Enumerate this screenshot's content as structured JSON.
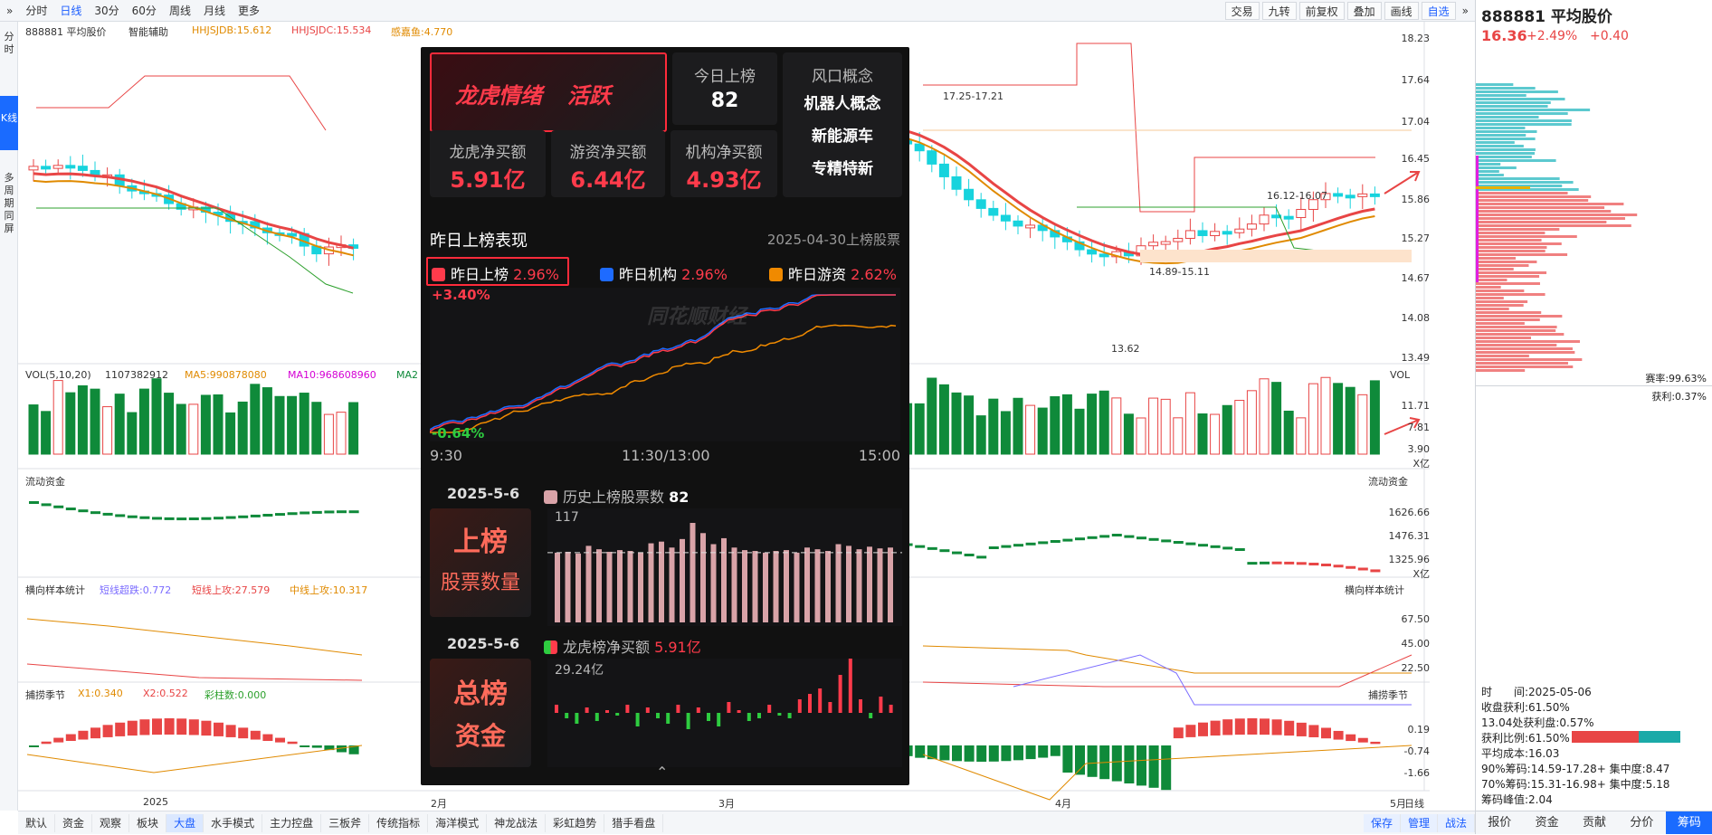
{
  "toolbar": {
    "chevron": "»",
    "periods": [
      "分时",
      "日线",
      "30分",
      "60分",
      "周线",
      "月线",
      "更多"
    ],
    "active_period": "日线",
    "right_items": [
      "交易",
      "九转",
      "前复权",
      "叠加",
      "画线",
      "自选"
    ],
    "right_chevron": "»"
  },
  "left_rail": {
    "items": [
      "分时",
      "K线",
      "多周期同屏"
    ],
    "active": "K线"
  },
  "main_chart": {
    "name": "888881 平均股价",
    "assist": "智能辅助",
    "indicators": [
      {
        "label": "HHJSJDB:15.612",
        "color": "#e08a00"
      },
      {
        "label": "HHJSJDC:15.534",
        "color": "#e84545"
      },
      {
        "label": "感嘉鱼:4.770",
        "color": "#e08a00"
      }
    ],
    "y_ticks": [
      "18.23",
      "17.64",
      "17.04",
      "16.45",
      "15.86",
      "15.27",
      "14.67",
      "14.08",
      "13.49"
    ],
    "annotations": [
      "17.25-17.21",
      "16.12-16.07",
      "14.89-15.11",
      "13.62"
    ]
  },
  "vol_panel": {
    "title": "VOL(5,10,20)",
    "value": "1107382912",
    "ma5": "MA5:990878080",
    "ma10": "MA10:968608960",
    "ma20": "MA2",
    "label_right": "VOL",
    "y_ticks": [
      "11.71",
      "7.81",
      "3.90",
      "X亿"
    ]
  },
  "flow_panel": {
    "title": "流动资金",
    "label_right": "流动资金",
    "y_ticks": [
      "1626.66",
      "1476.31",
      "1325.96",
      "X亿"
    ]
  },
  "sample_panel": {
    "title": "横向样本统计",
    "items": [
      {
        "label": "短线超跌:0.772",
        "color": "#7b6cff"
      },
      {
        "label": "短线上攻:27.579",
        "color": "#e84545"
      },
      {
        "label": "中线上攻:10.317",
        "color": "#e08a00"
      }
    ],
    "label_right": "横向样本统计",
    "y_ticks": [
      "67.50",
      "45.00",
      "22.50"
    ]
  },
  "season_panel": {
    "title": "捕捞季节",
    "items": [
      {
        "label": "X1:0.340",
        "color": "#e08a00"
      },
      {
        "label": "X2:0.522",
        "color": "#e84545"
      },
      {
        "label": "彩柱数:0.000",
        "color": "#2ca02c"
      }
    ],
    "label_right": "捕捞季节",
    "y_ticks": [
      "0.19",
      "-0.74",
      "-1.66"
    ]
  },
  "x_axis": {
    "labels": [
      "2025",
      "2月",
      "3月",
      "4月",
      "5月"
    ],
    "right_label": "日线"
  },
  "bottom_tabs": [
    "默认",
    "资金",
    "观察",
    "板块",
    "大盘",
    "水手模式",
    "主力控盘",
    "三板斧",
    "传统指标",
    "海洋模式",
    "神龙战法",
    "彩虹趋势",
    "猎手看盘"
  ],
  "bottom_active": "大盘",
  "bottom_right": [
    "保存",
    "管理",
    "战法"
  ],
  "popup": {
    "mood_title": "龙虎情绪",
    "mood_value": "活跃",
    "today_label": "今日上榜",
    "today_value": "82",
    "concept_title": "风口概念",
    "concepts": [
      "机器人概念",
      "新能源车",
      "专精特新"
    ],
    "buy_cells": [
      {
        "label": "龙虎净买额",
        "value": "5.91亿"
      },
      {
        "label": "游资净买额",
        "value": "6.44亿"
      },
      {
        "label": "机构净买额",
        "value": "4.93亿"
      }
    ],
    "perf_title": "昨日上榜表现",
    "perf_date": "2025-04-30上榜股票",
    "legend": [
      {
        "label": "昨日上榜",
        "value": "2.96%",
        "color": "#ff3b4b"
      },
      {
        "label": "昨日机构",
        "value": "2.96%",
        "color": "#1e6bff"
      },
      {
        "label": "昨日游资",
        "value": "2.62%",
        "color": "#f08a00"
      }
    ],
    "perf_high": "+3.40%",
    "perf_low": "-0.64%",
    "perf_times": [
      "9:30",
      "11:30/13:00",
      "15:00"
    ],
    "watermark": "同花顺财经",
    "count_date": "2025-5-6",
    "count_label": "历史上榜股票数",
    "count_value": "82",
    "count_side_title": "上榜",
    "count_side_sub": "股票数量",
    "count_max": "117",
    "count_bars": [
      82,
      83,
      81,
      90,
      86,
      83,
      85,
      84,
      82,
      93,
      95,
      88,
      98,
      117,
      105,
      92,
      99,
      88,
      85,
      84,
      82,
      84,
      85,
      82,
      88,
      86,
      84,
      92,
      90,
      86,
      89,
      87,
      88
    ],
    "fund_date": "2025-5-6",
    "fund_label": "龙虎榜净买额",
    "fund_value": "5.91亿",
    "fund_side_title": "总榜",
    "fund_side_sub": "资金",
    "fund_max": "29.24亿",
    "fund_bars": [
      3,
      -2,
      -4,
      2,
      -3,
      1,
      -1,
      3,
      -5,
      2,
      -2,
      -4,
      3,
      -6,
      2,
      -3,
      -5,
      4,
      1,
      -3,
      -2,
      3,
      -1,
      -2,
      5,
      7,
      9,
      4,
      14,
      22,
      5,
      -2,
      6,
      3
    ],
    "collapse": "⌃"
  },
  "right_panel": {
    "code_name": "888881 平均股价",
    "price": "16.36",
    "change_pct": "+2.49%",
    "change_abs": "+0.40",
    "win_rate": "赛率:99.63%",
    "profit": "获利:0.37%",
    "info": [
      "时　　间:2025-05-06",
      "收盘获利:61.50%",
      "13.04处获利盘:0.57%",
      "获利比例:61.50%",
      "平均成本:16.03",
      "90%筹码:14.59-17.28+ 集中度:8.47",
      "70%筹码:15.31-16.98+ 集中度:5.18",
      "筹码峰值:2.04"
    ],
    "tabs": [
      "报价",
      "资金",
      "贡献",
      "分价",
      "筹码"
    ],
    "active_tab": "筹码"
  },
  "colors": {
    "up": "#e84545",
    "down": "#0f8a3a",
    "cyan": "#17d3dd",
    "accent": "#1a6bff"
  }
}
